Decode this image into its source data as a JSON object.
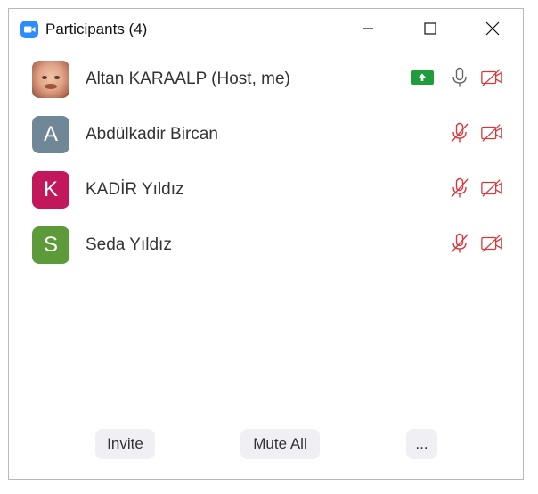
{
  "window": {
    "title": "Participants (4)",
    "app_icon": "zoom-camera-icon",
    "controls": [
      "minimize-icon",
      "maximize-icon",
      "close-icon"
    ]
  },
  "participants": [
    {
      "name": "Altan KARAALP (Host, me)",
      "avatar_letter": "",
      "avatar_type": "photo",
      "sharing": true,
      "mic": "on",
      "video": "off"
    },
    {
      "name": "Abdülkadir Bircan",
      "avatar_letter": "A",
      "avatar_color": "#6f8796",
      "sharing": false,
      "mic": "muted",
      "video": "off"
    },
    {
      "name": "KADİR Yıldız",
      "avatar_letter": "K",
      "avatar_color": "#c2185b",
      "sharing": false,
      "mic": "muted",
      "video": "off"
    },
    {
      "name": "Seda Yıldız",
      "avatar_letter": "S",
      "avatar_color": "#5d9b3a",
      "sharing": false,
      "mic": "muted",
      "video": "off"
    }
  ],
  "footer": {
    "invite_label": "Invite",
    "mute_all_label": "Mute All",
    "more_label": "..."
  },
  "colors": {
    "muted_red": "#d9383a",
    "share_green": "#1f9d3a",
    "button_bg": "#f0f0f4"
  }
}
